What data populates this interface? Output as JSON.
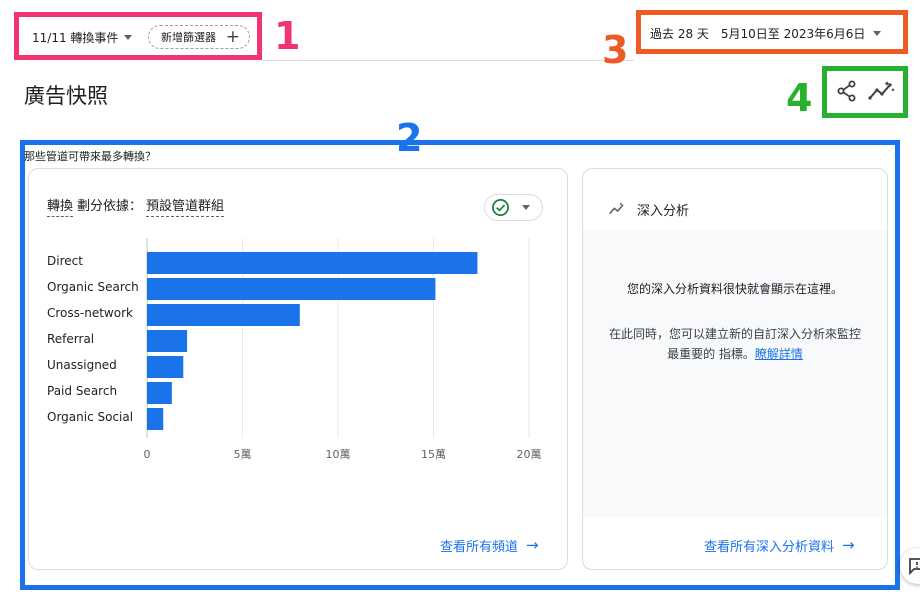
{
  "filters": {
    "events_label": "11/11 轉換事件",
    "add_filter_label": "新增篩選器"
  },
  "date_range": {
    "period": "過去 28 天",
    "range": "5月10日至 2023年6月6日"
  },
  "page_title": "廣告快照",
  "callouts": [
    "1",
    "2",
    "3",
    "4"
  ],
  "section_question": "那些管道可帶來最多轉換？",
  "chart_card": {
    "metric": "轉換",
    "split_label": "劃分依據：",
    "dimension": "預設管道群組",
    "view_all_label": "查看所有頻道"
  },
  "insight_card": {
    "title": "深入分析",
    "message": "您的深入分析資料很快就會顯示在這裡。",
    "sub_text": "在此同時，您可以建立新的自訂深入分析來監控最重要的 指標。",
    "learn_more": "瞭解詳情",
    "view_all_label": "查看所有深入分析資料"
  },
  "colors": {
    "bar": "#1a73e8",
    "callout_1": "#f0346e",
    "callout_2": "#1a73e8",
    "callout_3": "#ee5a24",
    "callout_4": "#27b12c"
  },
  "icons": [
    "chevron-down-icon",
    "plus-icon",
    "share-icon",
    "insights-icon",
    "check-circle-icon",
    "arrow-right-icon",
    "feedback-icon"
  ],
  "chart_data": {
    "type": "bar",
    "orientation": "horizontal",
    "categories": [
      "Direct",
      "Organic Search",
      "Cross-network",
      "Referral",
      "Unassigned",
      "Paid Search",
      "Organic Social"
    ],
    "values": [
      173000,
      151000,
      80000,
      21000,
      19000,
      13000,
      8500
    ],
    "x_ticks": [
      0,
      50000,
      100000,
      150000,
      200000
    ],
    "x_tick_labels": [
      "0",
      "5萬",
      "10萬",
      "15萬",
      "20萬"
    ],
    "xlim": [
      0,
      200000
    ],
    "grid": true
  }
}
